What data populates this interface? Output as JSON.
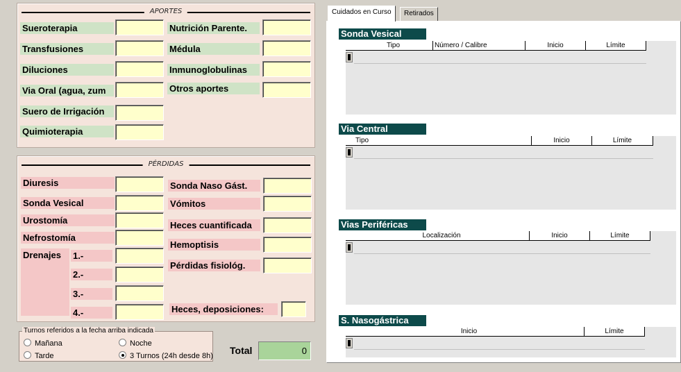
{
  "aportes": {
    "title": "APORTES",
    "items_left": [
      "Sueroterapia",
      "Transfusiones",
      "Diluciones",
      "Via Oral (agua, zum",
      "Suero de Irrigación",
      "Quimioterapia"
    ],
    "items_right": [
      "Nutrición Parente.",
      "Médula",
      "Inmunoglobulinas",
      "Otros aportes"
    ]
  },
  "perdidas": {
    "title": "PÉRDIDAS",
    "items_left": [
      "Diuresis",
      "Sonda Vesical",
      "Urostomía",
      "Nefrostomía"
    ],
    "drenajes_label": "Drenajes",
    "drenajes": [
      "1.-",
      "2.-",
      "3.-",
      "4.-"
    ],
    "items_right": [
      "Sonda Naso Gást.",
      "Vómitos",
      "Heces cuantificada",
      "Hemoptisis",
      "Pérdidas fisiológ."
    ],
    "heces_deposiciones": "Heces, deposiciones:"
  },
  "turnos": {
    "title": "Turnos referidos a la fecha arriba indicada",
    "options": [
      "Mañana",
      "Noche",
      "Tarde",
      "3 Turnos (24h desde 8h)"
    ],
    "selected": "3 Turnos (24h desde 8h)"
  },
  "total": {
    "label": "Total",
    "value": "0"
  },
  "tabs": [
    "Cuidados en Curso",
    "Retirados"
  ],
  "active_tab": "Cuidados en Curso",
  "sections": [
    {
      "title": "Sonda Vesical",
      "columns": [
        "Tipo",
        "Número / Calibre",
        "Inicio",
        "Límite"
      ]
    },
    {
      "title": "Via Central",
      "columns": [
        "Tipo",
        "Inicio",
        "Límite"
      ]
    },
    {
      "title": "Vias Periféricas",
      "columns": [
        "Localización",
        "Inicio",
        "Límite"
      ]
    },
    {
      "title": "S. Nasogástrica",
      "columns": [
        "Inicio",
        "Límite"
      ]
    }
  ],
  "colors": {
    "panel_bg": "#f5e4dc",
    "label_green": "#cfe3c6",
    "label_pink": "#f4c7c7",
    "field_yellow": "#ffffcc",
    "section_header": "#0d4a4a",
    "total_green": "#a9d49a"
  }
}
